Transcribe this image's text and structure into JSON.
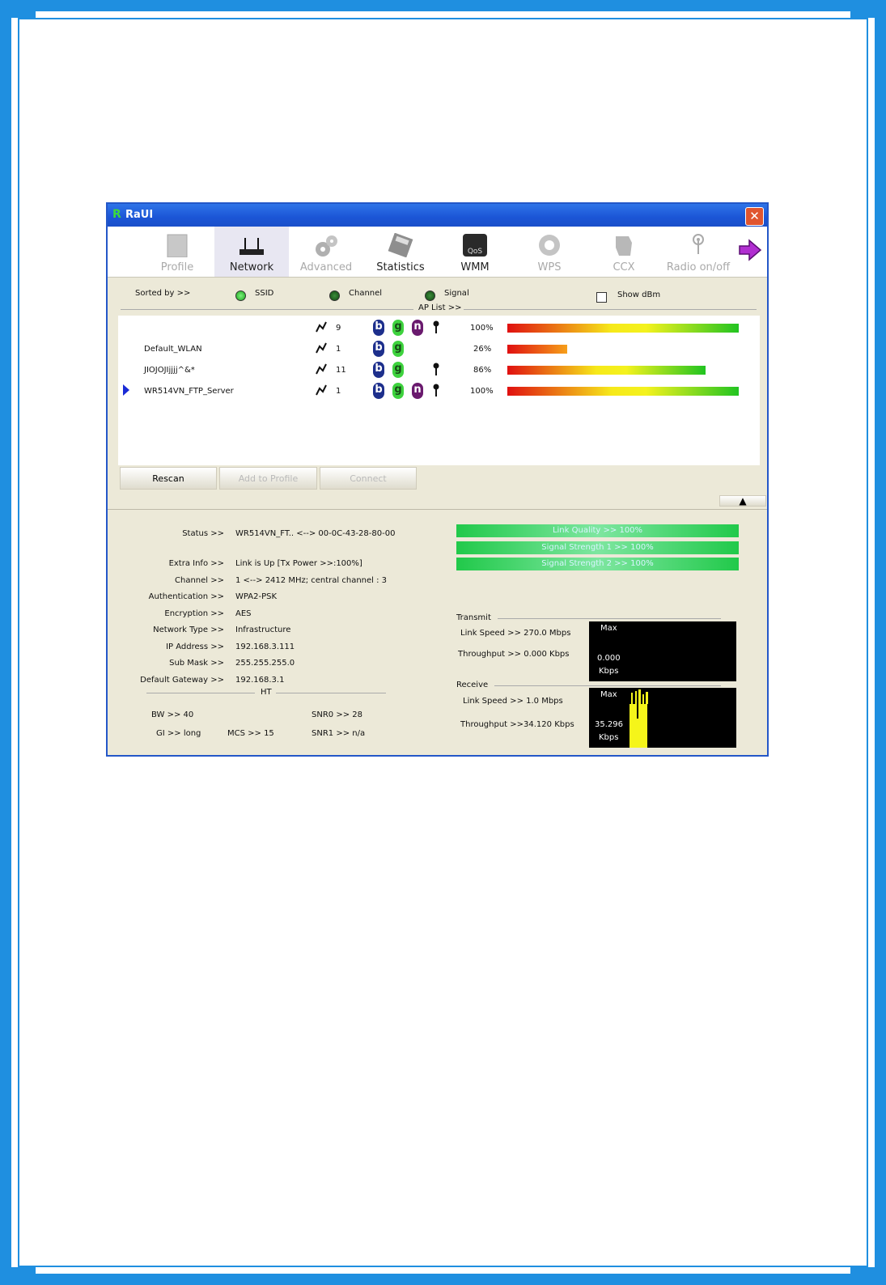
{
  "window": {
    "title": "RaUI",
    "logo_letter": "R"
  },
  "toolbar": {
    "items": [
      {
        "label": "Profile",
        "icon": "profile-icon",
        "state": "disabled"
      },
      {
        "label": "Network",
        "icon": "router-icon",
        "state": "active"
      },
      {
        "label": "Advanced",
        "icon": "gears-icon",
        "state": "disabled"
      },
      {
        "label": "Statistics",
        "icon": "calculator-icon",
        "state": "normal"
      },
      {
        "label": "WMM",
        "icon": "qos-icon",
        "state": "normal"
      },
      {
        "label": "WPS",
        "icon": "wps-icon",
        "state": "disabled"
      },
      {
        "label": "CCX",
        "icon": "ccx-icon",
        "state": "disabled"
      },
      {
        "label": "Radio on/off",
        "icon": "antenna-icon",
        "state": "disabled"
      }
    ],
    "next_icon": "arrow-right-icon"
  },
  "sort": {
    "label": "Sorted by >>",
    "options": [
      "SSID",
      "Channel",
      "Signal"
    ],
    "selected": "SSID",
    "show_dbm_label": "Show dBm",
    "show_dbm_checked": false
  },
  "ap_list": {
    "label": "AP List >>",
    "rows": [
      {
        "ssid": "",
        "channel": "9",
        "modes": [
          "b",
          "g",
          "n"
        ],
        "secured": true,
        "signal": "100%",
        "signal_pct": 100,
        "selected": false
      },
      {
        "ssid": "Default_WLAN",
        "channel": "1",
        "modes": [
          "b",
          "g"
        ],
        "secured": false,
        "signal": "26%",
        "signal_pct": 26,
        "selected": false
      },
      {
        "ssid": "JIOJOJIjjjj^&*",
        "channel": "11",
        "modes": [
          "b",
          "g"
        ],
        "secured": true,
        "signal": "86%",
        "signal_pct": 86,
        "selected": false
      },
      {
        "ssid": "WR514VN_FTP_Server",
        "channel": "1",
        "modes": [
          "b",
          "g",
          "n"
        ],
        "secured": true,
        "signal": "100%",
        "signal_pct": 100,
        "selected": true
      }
    ]
  },
  "buttons": {
    "rescan": "Rescan",
    "add_to_profile": "Add to Profile",
    "connect": "Connect"
  },
  "status": {
    "rows": [
      {
        "label": "Status >>",
        "value": "WR514VN_FT.. <--> 00-0C-43-28-80-00"
      },
      {
        "label": "Extra Info >>",
        "value": "Link is Up [Tx Power >>:100%]"
      },
      {
        "label": "Channel >>",
        "value": "1 <--> 2412 MHz; central channel : 3"
      },
      {
        "label": "Authentication >>",
        "value": "WPA2-PSK"
      },
      {
        "label": "Encryption >>",
        "value": "AES"
      },
      {
        "label": "Network Type >>",
        "value": "Infrastructure"
      },
      {
        "label": "IP Address >>",
        "value": "192.168.3.111"
      },
      {
        "label": "Sub Mask >>",
        "value": "255.255.255.0"
      },
      {
        "label": "Default Gateway >>",
        "value": "192.168.3.1"
      }
    ],
    "ht_label": "HT",
    "bw": "BW >>  40",
    "gi": "GI >>  long",
    "mcs": "MCS >>   15",
    "snr0": "SNR0 >>  28",
    "snr1": "SNR1 >>  n/a"
  },
  "quality": {
    "link_quality": "Link Quality >> 100%",
    "signal_1": "Signal Strength 1 >> 100%",
    "signal_2": "Signal Strength 2 >> 100%"
  },
  "transmit": {
    "label": "Transmit",
    "link_speed": "Link Speed >>  270.0 Mbps",
    "throughput": "Throughput >> 0.000 Kbps",
    "graph_max": "Max",
    "graph_value": "0.000",
    "graph_unit": "Kbps"
  },
  "receive": {
    "label": "Receive",
    "link_speed": "Link Speed >> 1.0 Mbps",
    "throughput": "Throughput >>34.120 Kbps",
    "graph_max": "Max",
    "graph_value": "35.296",
    "graph_unit": "Kbps"
  },
  "colors": {
    "frame": "#1f8fe0",
    "titlebar": "#1b55d6",
    "window_bg": "#ece9d8",
    "receive_bar": "#f5f51a"
  }
}
